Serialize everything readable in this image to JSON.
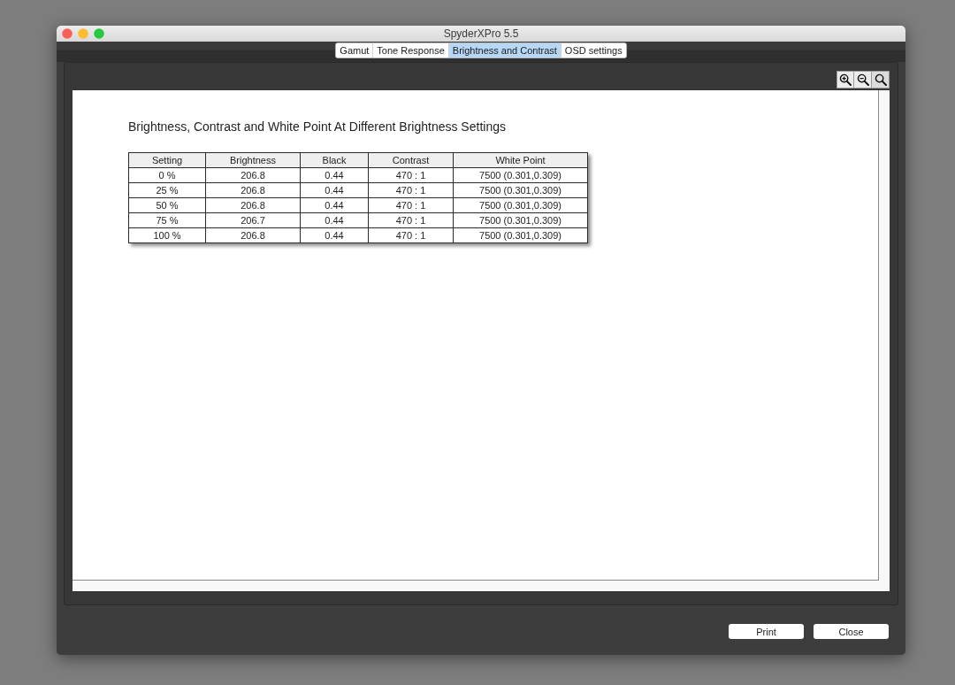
{
  "window": {
    "title": "SpyderXPro 5.5"
  },
  "tabs": [
    {
      "label": "Gamut",
      "selected": false
    },
    {
      "label": "Tone Response",
      "selected": false
    },
    {
      "label": "Brightness and Contrast",
      "selected": true
    },
    {
      "label": "OSD settings",
      "selected": false
    }
  ],
  "report": {
    "title": "Brightness, Contrast and White Point At Different Brightness Settings",
    "table": {
      "columns": [
        "Setting",
        "Brightness",
        "Black",
        "Contrast",
        "White Point"
      ],
      "rows": [
        [
          "0 %",
          "206.8",
          "0.44",
          "470 : 1",
          "7500 (0.301,0.309)"
        ],
        [
          "25 %",
          "206.8",
          "0.44",
          "470 : 1",
          "7500 (0.301,0.309)"
        ],
        [
          "50 %",
          "206.8",
          "0.44",
          "470 : 1",
          "7500 (0.301,0.309)"
        ],
        [
          "75 %",
          "206.7",
          "0.44",
          "470 : 1",
          "7500 (0.301,0.309)"
        ],
        [
          "100 %",
          "206.8",
          "0.44",
          "470 : 1",
          "7500 (0.301,0.309)"
        ]
      ]
    }
  },
  "buttons": [
    "Print",
    "Close"
  ]
}
